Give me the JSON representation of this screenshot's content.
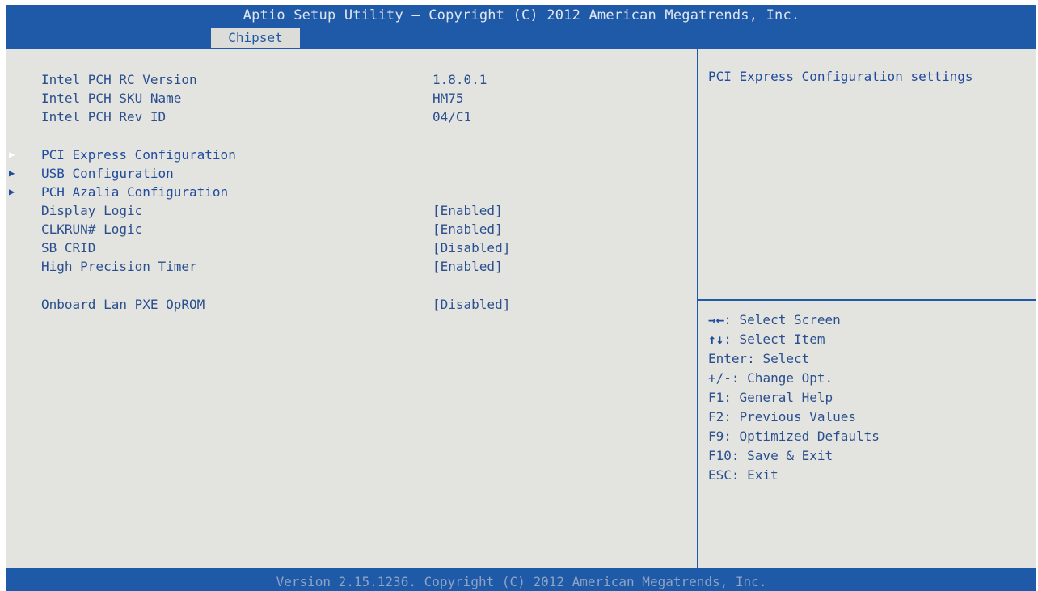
{
  "header": {
    "title": "Aptio Setup Utility – Copyright (C) 2012 American Megatrends, Inc.",
    "active_tab": "Chipset"
  },
  "main": {
    "info_rows": [
      {
        "label": "Intel PCH RC Version",
        "value": "1.8.0.1"
      },
      {
        "label": "Intel PCH SKU Name",
        "value": "HM75"
      },
      {
        "label": "Intel PCH Rev ID",
        "value": "04/C1"
      }
    ],
    "submenus": [
      {
        "label": "PCI Express Configuration",
        "selected": true
      },
      {
        "label": "USB Configuration",
        "selected": false
      },
      {
        "label": "PCH Azalia Configuration",
        "selected": false
      }
    ],
    "settings": [
      {
        "label": "Display Logic",
        "value": "[Enabled]"
      },
      {
        "label": "CLKRUN# Logic",
        "value": "[Enabled]"
      },
      {
        "label": "SB CRID",
        "value": "[Disabled]"
      },
      {
        "label": "High Precision Timer",
        "value": "[Enabled]"
      }
    ],
    "lan_setting": {
      "label": "Onboard Lan PXE OpROM",
      "value": "[Disabled]"
    }
  },
  "help": {
    "description": "PCI Express Configuration settings",
    "keys": [
      {
        "key": "→←",
        "desc": ": Select Screen"
      },
      {
        "key": "↑↓",
        "desc": ": Select Item"
      },
      {
        "key": "Enter",
        "desc": ": Select"
      },
      {
        "key": "+/-",
        "desc": ": Change Opt."
      },
      {
        "key": "F1",
        "desc": ": General Help"
      },
      {
        "key": "F2",
        "desc": ": Previous Values"
      },
      {
        "key": "F9",
        "desc": ": Optimized Defaults"
      },
      {
        "key": "F10",
        "desc": ": Save & Exit"
      },
      {
        "key": "ESC",
        "desc": ": Exit"
      }
    ]
  },
  "footer": {
    "text": "Version 2.15.1236. Copyright (C) 2012 American Megatrends, Inc."
  },
  "colors": {
    "bios_blue": "#1f5aa8",
    "background": "#e3e3e0",
    "text_blue": "#2a4f8e",
    "highlight": "#ffffff"
  }
}
